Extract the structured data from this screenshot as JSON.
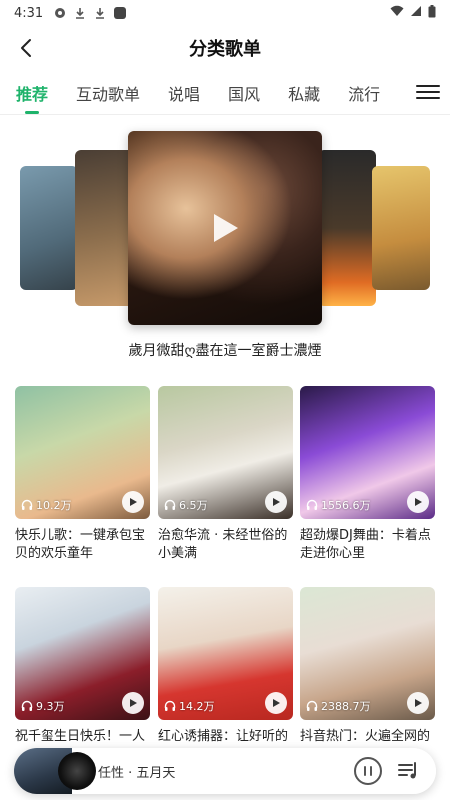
{
  "status_bar": {
    "time": "4:31"
  },
  "header": {
    "title": "分类歌单"
  },
  "tabs": [
    {
      "label": "推荐",
      "active": true
    },
    {
      "label": "互动歌单",
      "active": false
    },
    {
      "label": "说唱",
      "active": false
    },
    {
      "label": "国风",
      "active": false
    },
    {
      "label": "私藏",
      "active": false
    },
    {
      "label": "流行",
      "active": false
    }
  ],
  "carousel": {
    "caption": "歲月微甜ღ盡在這一室爵士濃煙"
  },
  "playlists": [
    {
      "title": "快乐儿歌：一键承包宝贝的欢乐童年",
      "plays": "10.2万"
    },
    {
      "title": "治愈华流 · 未经世俗的小美满",
      "plays": "6.5万"
    },
    {
      "title": "超劲爆DJ舞曲：卡着点走进你心里",
      "plays": "1556.6万"
    },
    {
      "title": "祝千玺生日快乐！一人",
      "plays": "9.3万"
    },
    {
      "title": "红心诱捕器：让好听的",
      "plays": "14.2万"
    },
    {
      "title": "抖音热门：火遍全网的",
      "plays": "2388.7万"
    }
  ],
  "player": {
    "now_playing": "任性 · 五月天"
  },
  "colors": {
    "accent": "#1fb36b"
  }
}
